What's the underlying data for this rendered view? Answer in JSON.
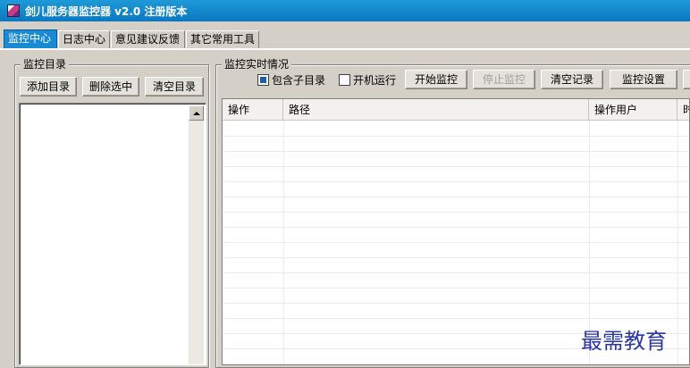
{
  "window": {
    "title": "剑儿服务器监控器 v2.0  注册版本"
  },
  "tabs": [
    "监控中心",
    "日志中心",
    "意见建议反馈",
    "其它常用工具"
  ],
  "left_panel": {
    "title": "监控目录",
    "buttons": {
      "add": "添加目录",
      "delete": "删除选中",
      "clear": "清空目录"
    }
  },
  "right_panel": {
    "title": "监控实时情况",
    "include_subdirs": {
      "label": "包含子目录",
      "checked": true
    },
    "autostart": {
      "label": "开机运行",
      "checked": false
    },
    "buttons": {
      "start": "开始监控",
      "stop": "停止监控",
      "clear_log": "清空记录",
      "settings": "监控设置"
    },
    "table": {
      "columns": [
        "操作",
        "路径",
        "操作用户",
        "时"
      ]
    }
  },
  "watermark": "最需教育"
}
